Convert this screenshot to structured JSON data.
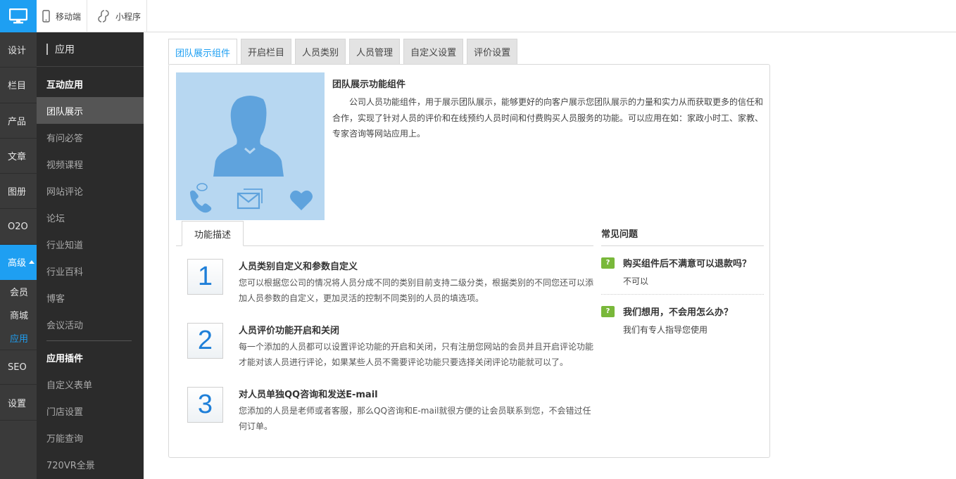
{
  "topbar": {
    "mobile_label": "移动端",
    "miniprogram_label": "小程序"
  },
  "leftnav": {
    "items": [
      "设计",
      "栏目",
      "产品",
      "文章",
      "图册",
      "O2O"
    ],
    "active_label": "高级",
    "sub_items": [
      "会员",
      "商城",
      "应用"
    ],
    "bottom_items": [
      "SEO",
      "设置"
    ]
  },
  "subnav": {
    "header": "应用",
    "group1": "互动应用",
    "group1_items": [
      "团队展示",
      "有问必答",
      "视频课程",
      "网站评论",
      "论坛",
      "行业知道",
      "行业百科",
      "博客",
      "会议活动"
    ],
    "group2": "应用插件",
    "group2_items": [
      "自定义表单",
      "门店设置",
      "万能查询",
      "720VR全景"
    ]
  },
  "tabs": [
    "团队展示组件",
    "开启栏目",
    "人员类别",
    "人员管理",
    "自定义设置",
    "评价设置"
  ],
  "intro": {
    "title": "团队展示功能组件",
    "text": "公司人员功能组件，用于展示团队展示，能够更好的向客户展示您团队展示的力量和实力从而获取更多的信任和合作，实现了针对人员的评价和在线预约人员时间和付费购买人员服务的功能。可以应用在如：家政小时工、家教、专家咨询等网站应用上。"
  },
  "features": {
    "tab_label": "功能描述",
    "items": [
      {
        "num": "1",
        "title": "人员类别自定义和参数自定义",
        "desc": "您可以根据您公司的情况将人员分成不同的类别目前支持二级分类，根据类别的不同您还可以添加人员参数的自定义，更加灵活的控制不同类别的人员的填选项。"
      },
      {
        "num": "2",
        "title": "人员评价功能开启和关闭",
        "desc": "每一个添加的人员都可以设置评论功能的开启和关闭，只有注册您网站的会员并且开启评论功能才能对该人员进行评论，如果某些人员不需要评论功能只要选择关闭评论功能就可以了。"
      },
      {
        "num": "3",
        "title": "对人员单独QQ咨询和发送E-mail",
        "desc": "您添加的人员是老师或者客服，那么QQ咨询和E-mail就很方便的让会员联系到您，不会错过任何订单。"
      }
    ]
  },
  "faq": {
    "title": "常见问题",
    "items": [
      {
        "q": "购买组件后不满意可以退款吗？",
        "a": "不可以"
      },
      {
        "q": "我们想用，不会用怎么办？",
        "a": "我们有专人指导您使用"
      }
    ]
  },
  "colors": {
    "accent": "#1e9ff2",
    "nav_dark": "#3a3a3a",
    "subnav_dark": "#2b2b2b",
    "hero_bg": "#b7d7f1",
    "faq_icon": "#79b83a"
  }
}
